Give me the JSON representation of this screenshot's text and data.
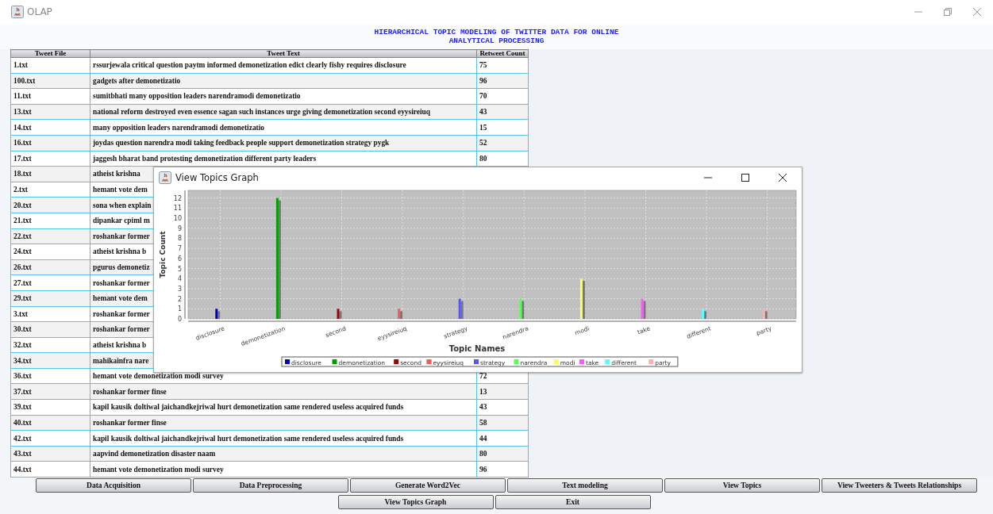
{
  "window": {
    "title": "OLAP"
  },
  "header": {
    "lines": [
      "HIERARCHICAL TOPIC MODELING OF TWITTER DATA FOR ONLINE",
      "ANALYTICAL PROCESSING"
    ]
  },
  "table": {
    "columns": [
      "Tweet File",
      "Tweet Text",
      "Retweet Count"
    ],
    "rows": [
      {
        "file": "1.txt",
        "text": "rssurjewala critical question paytm informed demonetization edict clearly fishy requires disclosure",
        "count": "75"
      },
      {
        "file": "100.txt",
        "text": "gadgets after demonetizatio",
        "count": "96"
      },
      {
        "file": "11.txt",
        "text": "sumitbhati many opposition leaders narendramodi demonetizatio",
        "count": "70"
      },
      {
        "file": "13.txt",
        "text": "national reform destroyed even essence sagan such instances urge giving demonetization second eyysireiuq",
        "count": "43"
      },
      {
        "file": "14.txt",
        "text": "many opposition leaders narendramodi demonetizatio",
        "count": "15"
      },
      {
        "file": "16.txt",
        "text": "joydas question narendra modi taking feedback people support demonetization strategy pygk",
        "count": "52"
      },
      {
        "file": "17.txt",
        "text": "jaggesh bharat band protesting demonetization different party leaders",
        "count": "80"
      },
      {
        "file": "18.txt",
        "text": "atheist krishna"
      },
      {
        "file": "2.txt",
        "text": "hemant vote dem"
      },
      {
        "file": "20.txt",
        "text": "sona when explain"
      },
      {
        "file": "21.txt",
        "text": "dipankar cpiml m"
      },
      {
        "file": "22.txt",
        "text": "roshankar former"
      },
      {
        "file": "24.txt",
        "text": "atheist krishna b"
      },
      {
        "file": "26.txt",
        "text": "pgurus demonetiz"
      },
      {
        "file": "27.txt",
        "text": "roshankar former"
      },
      {
        "file": "29.txt",
        "text": "hemant vote dem"
      },
      {
        "file": "3.txt",
        "text": "roshankar former"
      },
      {
        "file": "30.txt",
        "text": "roshankar former"
      },
      {
        "file": "32.txt",
        "text": "atheist krishna b"
      },
      {
        "file": "34.txt",
        "text": "mahikainfra nare"
      },
      {
        "file": "36.txt",
        "text": "hemant vote demonetization modi survey",
        "count": "72"
      },
      {
        "file": "37.txt",
        "text": "roshankar former finse",
        "count": "13"
      },
      {
        "file": "39.txt",
        "text": "kapil kausik doltiwal jaichandkejriwal hurt demonetization same rendered useless acquired funds",
        "count": "43"
      },
      {
        "file": "40.txt",
        "text": "roshankar former finse",
        "count": "58"
      },
      {
        "file": "42.txt",
        "text": "kapil kausik doltiwal jaichandkejriwal hurt demonetization same rendered useless acquired funds",
        "count": "44"
      },
      {
        "file": "43.txt",
        "text": "aapvind demonetization disaster naam",
        "count": "80"
      },
      {
        "file": "44.txt",
        "text": "hemant vote demonetization modi survey",
        "count": "96"
      }
    ]
  },
  "dialog": {
    "title": "View Topics Graph",
    "chart_data": {
      "type": "bar",
      "xlabel": "Topic Names",
      "ylabel": "Topic Count",
      "grid": true,
      "legend": true,
      "categories": [
        "disclosure",
        "demonetization",
        "second",
        "eyysireiuq",
        "strategy",
        "narendra",
        "modi",
        "take",
        "different",
        "party"
      ],
      "ylim": [
        0,
        12.6
      ],
      "yticks": [
        0,
        1,
        2,
        3,
        4,
        5,
        6,
        7,
        8,
        9,
        10,
        11,
        12
      ],
      "series": [
        {
          "name": "disclosure",
          "color": "#0000c0",
          "values": [
            1,
            null,
            null,
            null,
            null,
            null,
            null,
            null,
            null,
            null
          ]
        },
        {
          "name": "demonetization",
          "color": "#00a000",
          "values": [
            null,
            12,
            null,
            null,
            null,
            null,
            null,
            null,
            null,
            null
          ]
        },
        {
          "name": "second",
          "color": "#a00000",
          "values": [
            null,
            null,
            1,
            null,
            null,
            null,
            null,
            null,
            null,
            null
          ]
        },
        {
          "name": "eyysireiuq",
          "color": "#ff5555",
          "values": [
            null,
            null,
            null,
            1,
            null,
            null,
            null,
            null,
            null,
            null
          ]
        },
        {
          "name": "strategy",
          "color": "#5555ff",
          "values": [
            null,
            null,
            null,
            null,
            2,
            null,
            null,
            null,
            null,
            null
          ]
        },
        {
          "name": "narendra",
          "color": "#55ff55",
          "values": [
            null,
            null,
            null,
            null,
            null,
            2,
            null,
            null,
            null,
            null
          ]
        },
        {
          "name": "modi",
          "color": "#ffff55",
          "values": [
            null,
            null,
            null,
            null,
            null,
            null,
            4,
            null,
            null,
            null
          ]
        },
        {
          "name": "take",
          "color": "#ff55ff",
          "values": [
            null,
            null,
            null,
            null,
            null,
            null,
            null,
            2,
            null,
            null
          ]
        },
        {
          "name": "different",
          "color": "#55ffff",
          "values": [
            null,
            null,
            null,
            null,
            null,
            null,
            null,
            null,
            1,
            null
          ]
        },
        {
          "name": "party",
          "color": "#ffafaf",
          "values": [
            null,
            null,
            null,
            null,
            null,
            null,
            null,
            null,
            null,
            1
          ]
        }
      ]
    }
  },
  "buttons": [
    [
      "Data Acquisition",
      "Data Preprocessing",
      "Generate Word2Vec",
      "Text modeling",
      "View Topics",
      "View Tweeters & Tweets Relationships"
    ],
    [
      "View Topics Graph",
      "Exit"
    ]
  ]
}
